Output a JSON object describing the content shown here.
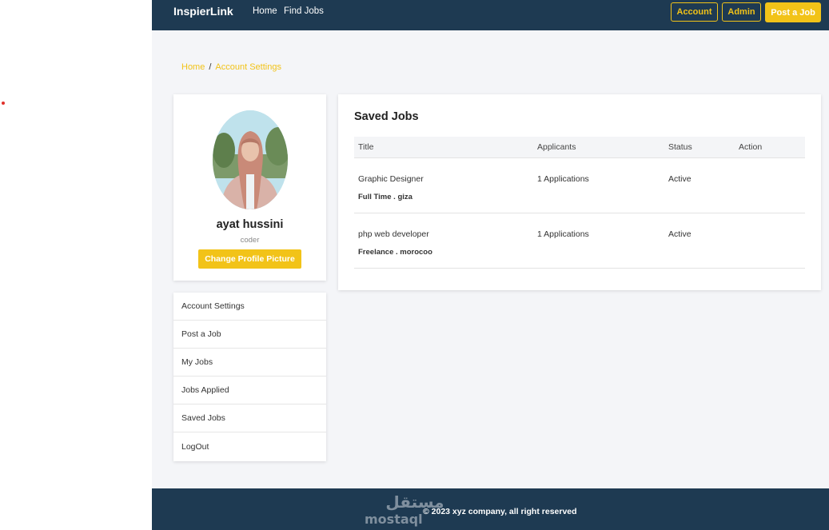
{
  "navbar": {
    "brand": "InspierLink",
    "links": [
      "Home",
      "Find Jobs"
    ],
    "account_label": "Account",
    "admin_label": "Admin",
    "post_job_label": "Post a Job"
  },
  "breadcrumb": {
    "home": "Home",
    "separator": "/",
    "current": "Account Settings"
  },
  "profile": {
    "name": "ayat hussini",
    "role": "coder",
    "change_picture_label": "Change Profile Picture"
  },
  "side_menu": {
    "items": [
      "Account Settings",
      "Post a Job",
      "My Jobs",
      "Jobs Applied",
      "Saved Jobs",
      "LogOut"
    ]
  },
  "saved_jobs": {
    "title": "Saved Jobs",
    "columns": [
      "Title",
      "Applicants",
      "Status",
      "Action"
    ],
    "rows": [
      {
        "title": "Graphic Designer",
        "meta": "Full Time . giza",
        "applicants": "1 Applications",
        "status": "Active"
      },
      {
        "title": "php web developer",
        "meta": "Freelance . morocoo",
        "applicants": "1 Applications",
        "status": "Active"
      }
    ]
  },
  "footer": {
    "copyright": "© 2023 xyz company, all right reserved"
  },
  "colors": {
    "navy": "#1e3a52",
    "accent": "#f2c318",
    "background": "#f4f5f8"
  },
  "watermark": {
    "arabic": "مستقل",
    "latin": "mostaql"
  }
}
